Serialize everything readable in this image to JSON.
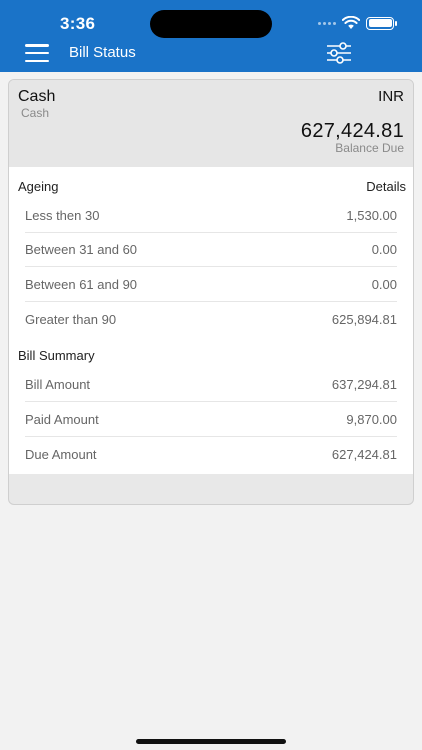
{
  "status_bar": {
    "time": "3:36"
  },
  "header": {
    "title": "Bill Status",
    "menu_icon": "hamburger-menu-icon",
    "filter_icon": "sliders-icon"
  },
  "account": {
    "name": "Cash",
    "subtitle": "Cash",
    "currency": "INR",
    "balance": "627,424.81",
    "balance_label": "Balance Due"
  },
  "ageing": {
    "title": "Ageing",
    "details_label": "Details",
    "rows": [
      {
        "label": "Less then 30",
        "value": "1,530.00"
      },
      {
        "label": "Between 31 and 60",
        "value": "0.00"
      },
      {
        "label": "Between 61 and 90",
        "value": "0.00"
      },
      {
        "label": "Greater than 90",
        "value": "625,894.81"
      }
    ]
  },
  "bill_summary": {
    "title": "Bill Summary",
    "rows": [
      {
        "label": "Bill Amount",
        "value": "637,294.81"
      },
      {
        "label": "Paid Amount",
        "value": "9,870.00"
      },
      {
        "label": "Due Amount",
        "value": "627,424.81"
      }
    ]
  },
  "colors": {
    "header_bg": "#1a73c8",
    "page_bg": "#f2f2f2",
    "card_header_bg": "#e6e6e6"
  }
}
